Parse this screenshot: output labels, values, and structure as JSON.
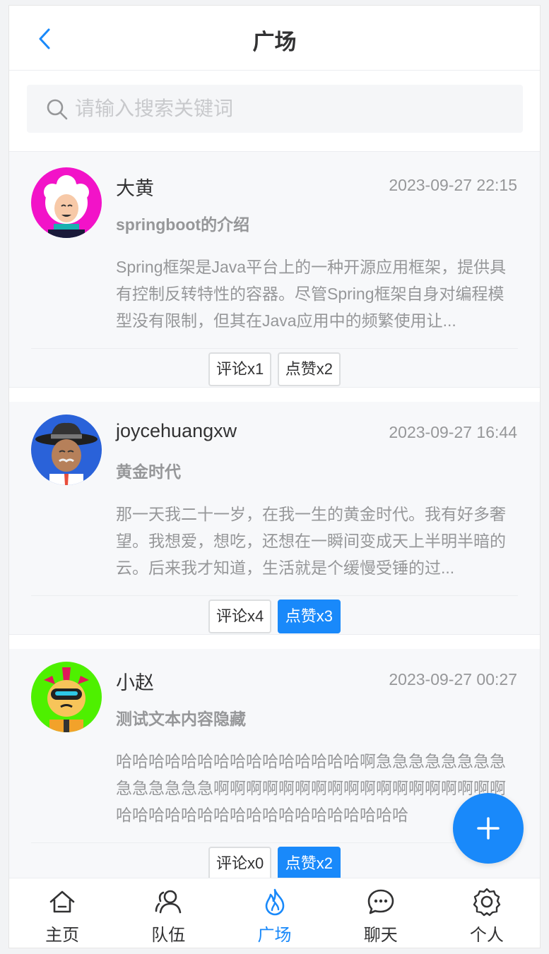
{
  "header": {
    "title": "广场"
  },
  "search": {
    "placeholder": "请输入搜索关键词",
    "value": ""
  },
  "posts": [
    {
      "username": "大黄",
      "time": "2023-09-27 22:15",
      "title": "springboot的介绍",
      "body": "Spring框架是Java平台上的一种开源应用框架，提供具有控制反转特性的容器。尽管Spring框架自身对编程模型没有限制，但其在Java应用中的频繁使用让...",
      "comment_label": "评论x1",
      "like_label": "点赞x2",
      "liked": false,
      "avatar_bg": "#f213c8"
    },
    {
      "username": "joycehuangxw",
      "time": "2023-09-27 16:44",
      "title": "黄金时代",
      "body": "那一天我二十一岁，在我一生的黄金时代。我有好多奢望。我想爱，想吃，还想在一瞬间变成天上半明半暗的云。后来我才知道，生活就是个缓慢受锤的过...",
      "comment_label": "评论x4",
      "like_label": "点赞x3",
      "liked": true,
      "avatar_bg": "#2a62d9"
    },
    {
      "username": "小赵",
      "time": "2023-09-27 00:27",
      "title": "测试文本内容隐藏",
      "body": "哈哈哈哈哈哈哈哈哈哈哈哈哈哈哈啊急急急急急急急急急急急急急急啊啊啊啊啊啊啊啊啊啊啊啊啊啊啊啊啊啊哈哈哈哈哈哈哈哈哈哈哈哈哈哈哈哈哈哈",
      "comment_label": "评论x0",
      "like_label": "点赞x2",
      "liked": true,
      "avatar_bg": "#4ef000"
    }
  ],
  "tabbar": {
    "items": [
      {
        "label": "主页",
        "icon": "home-icon",
        "active": false
      },
      {
        "label": "队伍",
        "icon": "team-icon",
        "active": false
      },
      {
        "label": "广场",
        "icon": "fire-icon",
        "active": true
      },
      {
        "label": "聊天",
        "icon": "chat-icon",
        "active": false
      },
      {
        "label": "个人",
        "icon": "gear-icon",
        "active": false
      }
    ]
  },
  "colors": {
    "primary": "#1989fa",
    "text": "#323233",
    "muted": "#969799"
  }
}
